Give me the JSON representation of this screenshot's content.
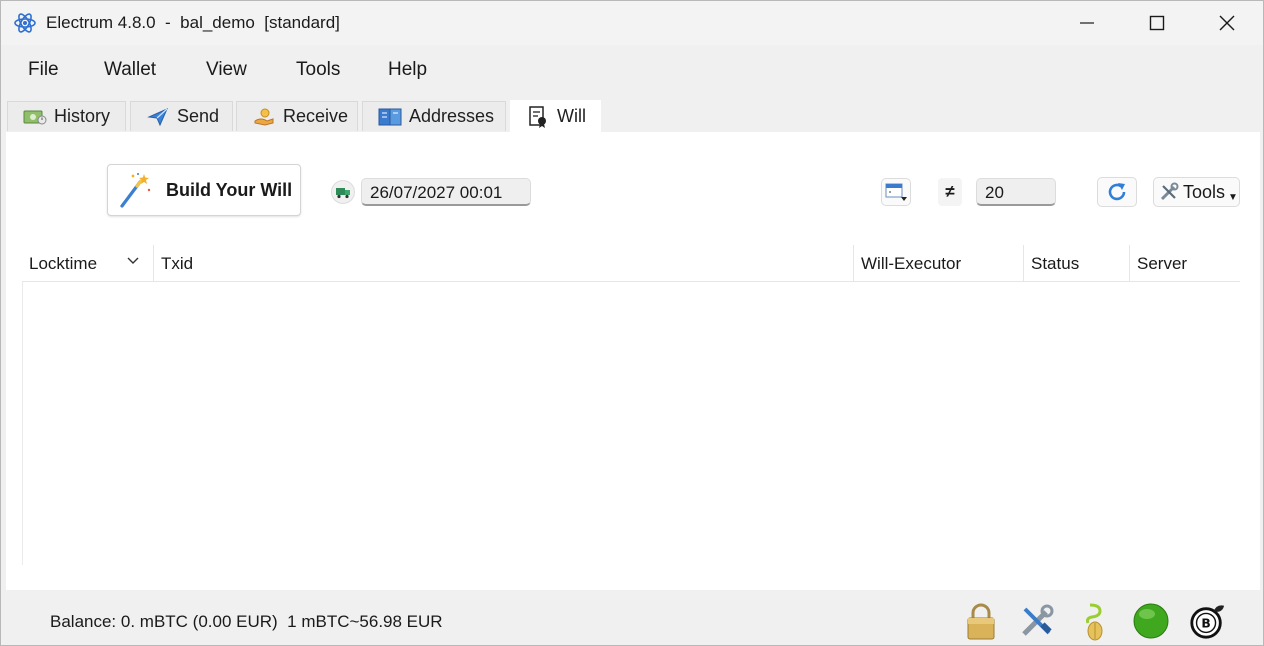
{
  "window": {
    "title": "Electrum 4.8.0  -  bal_demo  [standard]"
  },
  "menu": [
    "File",
    "Wallet",
    "View",
    "Tools",
    "Help"
  ],
  "tabs": [
    {
      "label": "History",
      "icon": "history-icon"
    },
    {
      "label": "Send",
      "icon": "send-icon"
    },
    {
      "label": "Receive",
      "icon": "receive-icon"
    },
    {
      "label": "Addresses",
      "icon": "addresses-icon"
    },
    {
      "label": "Will",
      "icon": "will-icon",
      "active": true
    }
  ],
  "will": {
    "build_label": "Build Your Will",
    "locktime_value": "26/07/2027 00:01",
    "threshold_value": "20",
    "threshold_icon_glyph": "≠",
    "tools_label": "Tools"
  },
  "table": {
    "columns": [
      "Locktime",
      "Txid",
      "Will-Executor",
      "Status",
      "Server"
    ],
    "rows": []
  },
  "status": {
    "balance": "Balance: 0. mBTC (0.00 EUR)  1 mBTC~56.98 EUR",
    "icons": [
      "lock-icon",
      "preferences-icon",
      "seed-icon",
      "network-status-icon",
      "plugin-icon"
    ]
  },
  "colors": {
    "accent": "#2f6fd1",
    "network_ok": "#3fa81e"
  }
}
